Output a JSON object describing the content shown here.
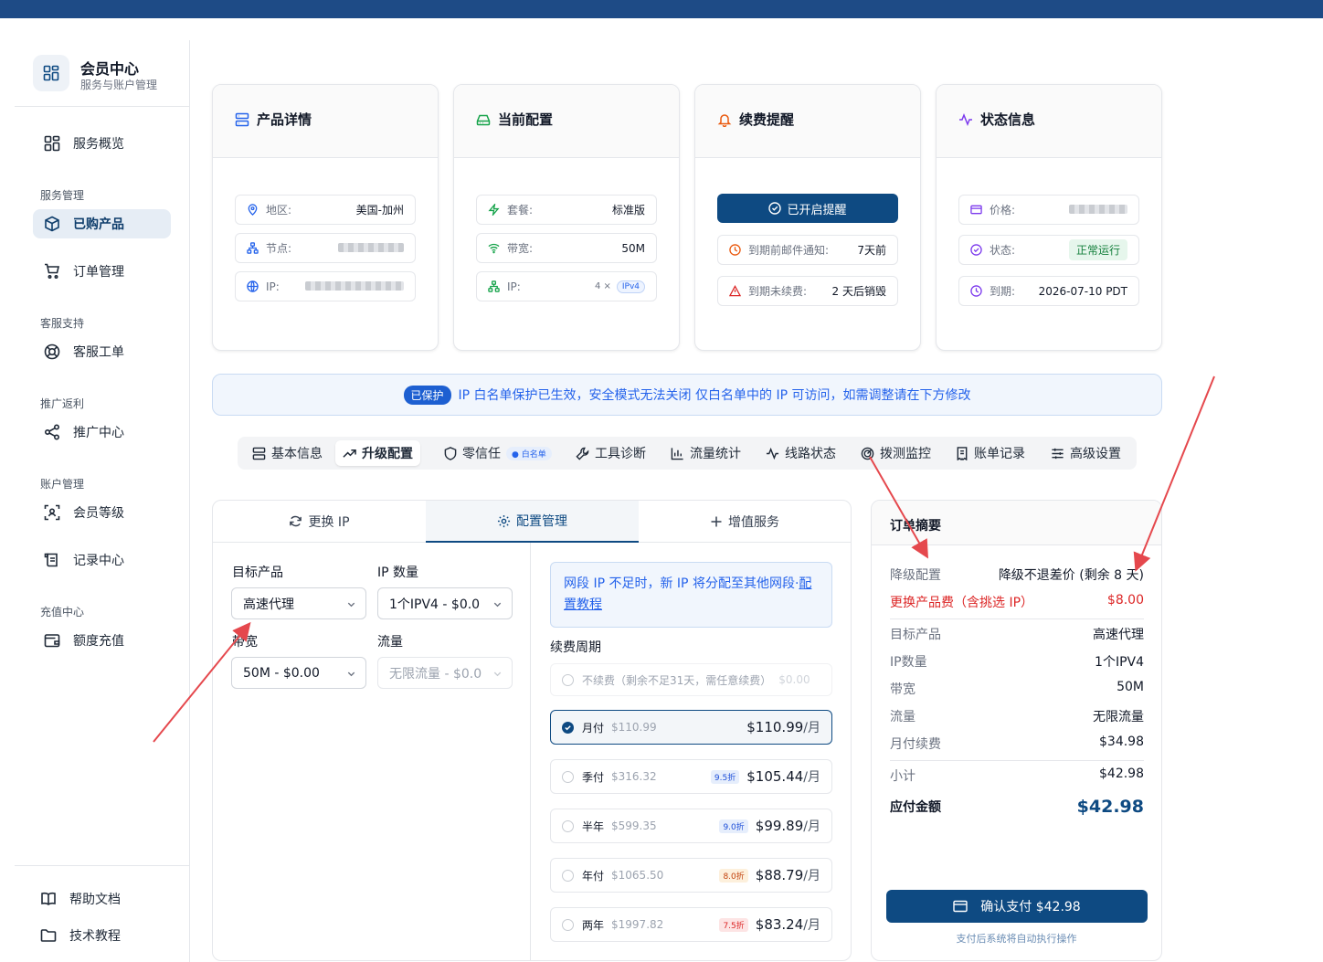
{
  "brand": {
    "title": "会员中心",
    "subtitle": "服务与账户管理"
  },
  "sidebar": {
    "overview": "服务概览",
    "groups": [
      {
        "label": "服务管理",
        "items": [
          "已购产品",
          "订单管理"
        ]
      },
      {
        "label": "客服支持",
        "items": [
          "客服工单"
        ]
      },
      {
        "label": "推广返利",
        "items": [
          "推广中心"
        ]
      },
      {
        "label": "账户管理",
        "items": [
          "会员等级",
          "记录中心"
        ]
      },
      {
        "label": "充值中心",
        "items": [
          "额度充值"
        ]
      }
    ],
    "footer": [
      "帮助文档",
      "技术教程"
    ]
  },
  "cards": {
    "product": {
      "title": "产品详情",
      "region_label": "地区:",
      "region_value": "美国-加州",
      "node_label": "节点:",
      "ip_label": "IP:"
    },
    "config": {
      "title": "当前配置",
      "plan_label": "套餐:",
      "plan_value": "标准版",
      "bw_label": "带宽:",
      "bw_value": "50M",
      "ip_label": "IP:",
      "ip_count": "4 ×",
      "ip_type": "IPv4"
    },
    "renew": {
      "title": "续费提醒",
      "button": "已开启提醒",
      "email_label": "到期前邮件通知:",
      "email_value": "7天前",
      "unpaid_label": "到期未续费:",
      "unpaid_value": "2 天后销毁"
    },
    "status": {
      "title": "状态信息",
      "price_label": "价格:",
      "state_label": "状态:",
      "state_value": "正常运行",
      "expire_label": "到期:",
      "expire_value": "2026-07-10 PDT"
    }
  },
  "banner": {
    "tag": "已保护",
    "text": "IP 白名单保护已生效，安全模式无法关闭  仅白名单中的 IP 可访问，如需调整请在下方修改"
  },
  "tabs": [
    "基本信息",
    "升级配置",
    "零信任",
    "工具诊断",
    "流量统计",
    "线路状态",
    "拨测监控",
    "账单记录",
    "高级设置"
  ],
  "tab_badge": "白名单",
  "panel_tabs": [
    "更换 IP",
    "配置管理",
    "增值服务"
  ],
  "form": {
    "target_label": "目标产品",
    "target_value": "高速代理",
    "ipcount_label": "IP 数量",
    "ipcount_value": "1个IPV4 - $0.00",
    "bw_label": "带宽",
    "bw_value": "50M - $0.00",
    "traffic_label": "流量",
    "traffic_value": "无限流量 - $0.0"
  },
  "info": {
    "text": "网段 IP 不足时，新 IP 将分配至其他网段·",
    "link": "配置教程"
  },
  "period_label": "续费周期",
  "periods": [
    {
      "name": "不续费（剩余不足31天，需任意续费）",
      "orig": "$0.00"
    },
    {
      "name": "月付",
      "orig": "$110.99",
      "price": "$110.99",
      "unit": "/月"
    },
    {
      "name": "季付",
      "orig": "$316.32",
      "disc": "9.5折",
      "price": "$105.44",
      "unit": "/月"
    },
    {
      "name": "半年",
      "orig": "$599.35",
      "disc": "9.0折",
      "price": "$99.89",
      "unit": "/月"
    },
    {
      "name": "年付",
      "orig": "$1065.50",
      "disc": "8.0折",
      "price": "$88.79",
      "unit": "/月"
    },
    {
      "name": "两年",
      "orig": "$1997.82",
      "disc": "7.5折",
      "price": "$83.24",
      "unit": "/月"
    }
  ],
  "summary": {
    "title": "订单摘要",
    "rows": [
      {
        "l": "降级配置",
        "v": "降级不退差价 (剩余 8 天)"
      },
      {
        "l": "更换产品费（含挑选 IP）",
        "v": "$8.00"
      },
      {
        "l": "目标产品",
        "v": "高速代理"
      },
      {
        "l": "IP数量",
        "v": "1个IPV4"
      },
      {
        "l": "带宽",
        "v": "50M"
      },
      {
        "l": "流量",
        "v": "无限流量"
      },
      {
        "l": "月付续费",
        "v": "$34.98"
      },
      {
        "l": "小计",
        "v": "$42.98"
      },
      {
        "l": "应付金额",
        "v": "$42.98"
      }
    ],
    "pay_button": "确认支付 $42.98",
    "pay_note": "支付后系统将自动执行操作"
  },
  "colors": {
    "primary": "#0e4a82",
    "accent_blue": "#2563eb",
    "danger": "#dc2626",
    "arrow": "#e5484d"
  }
}
